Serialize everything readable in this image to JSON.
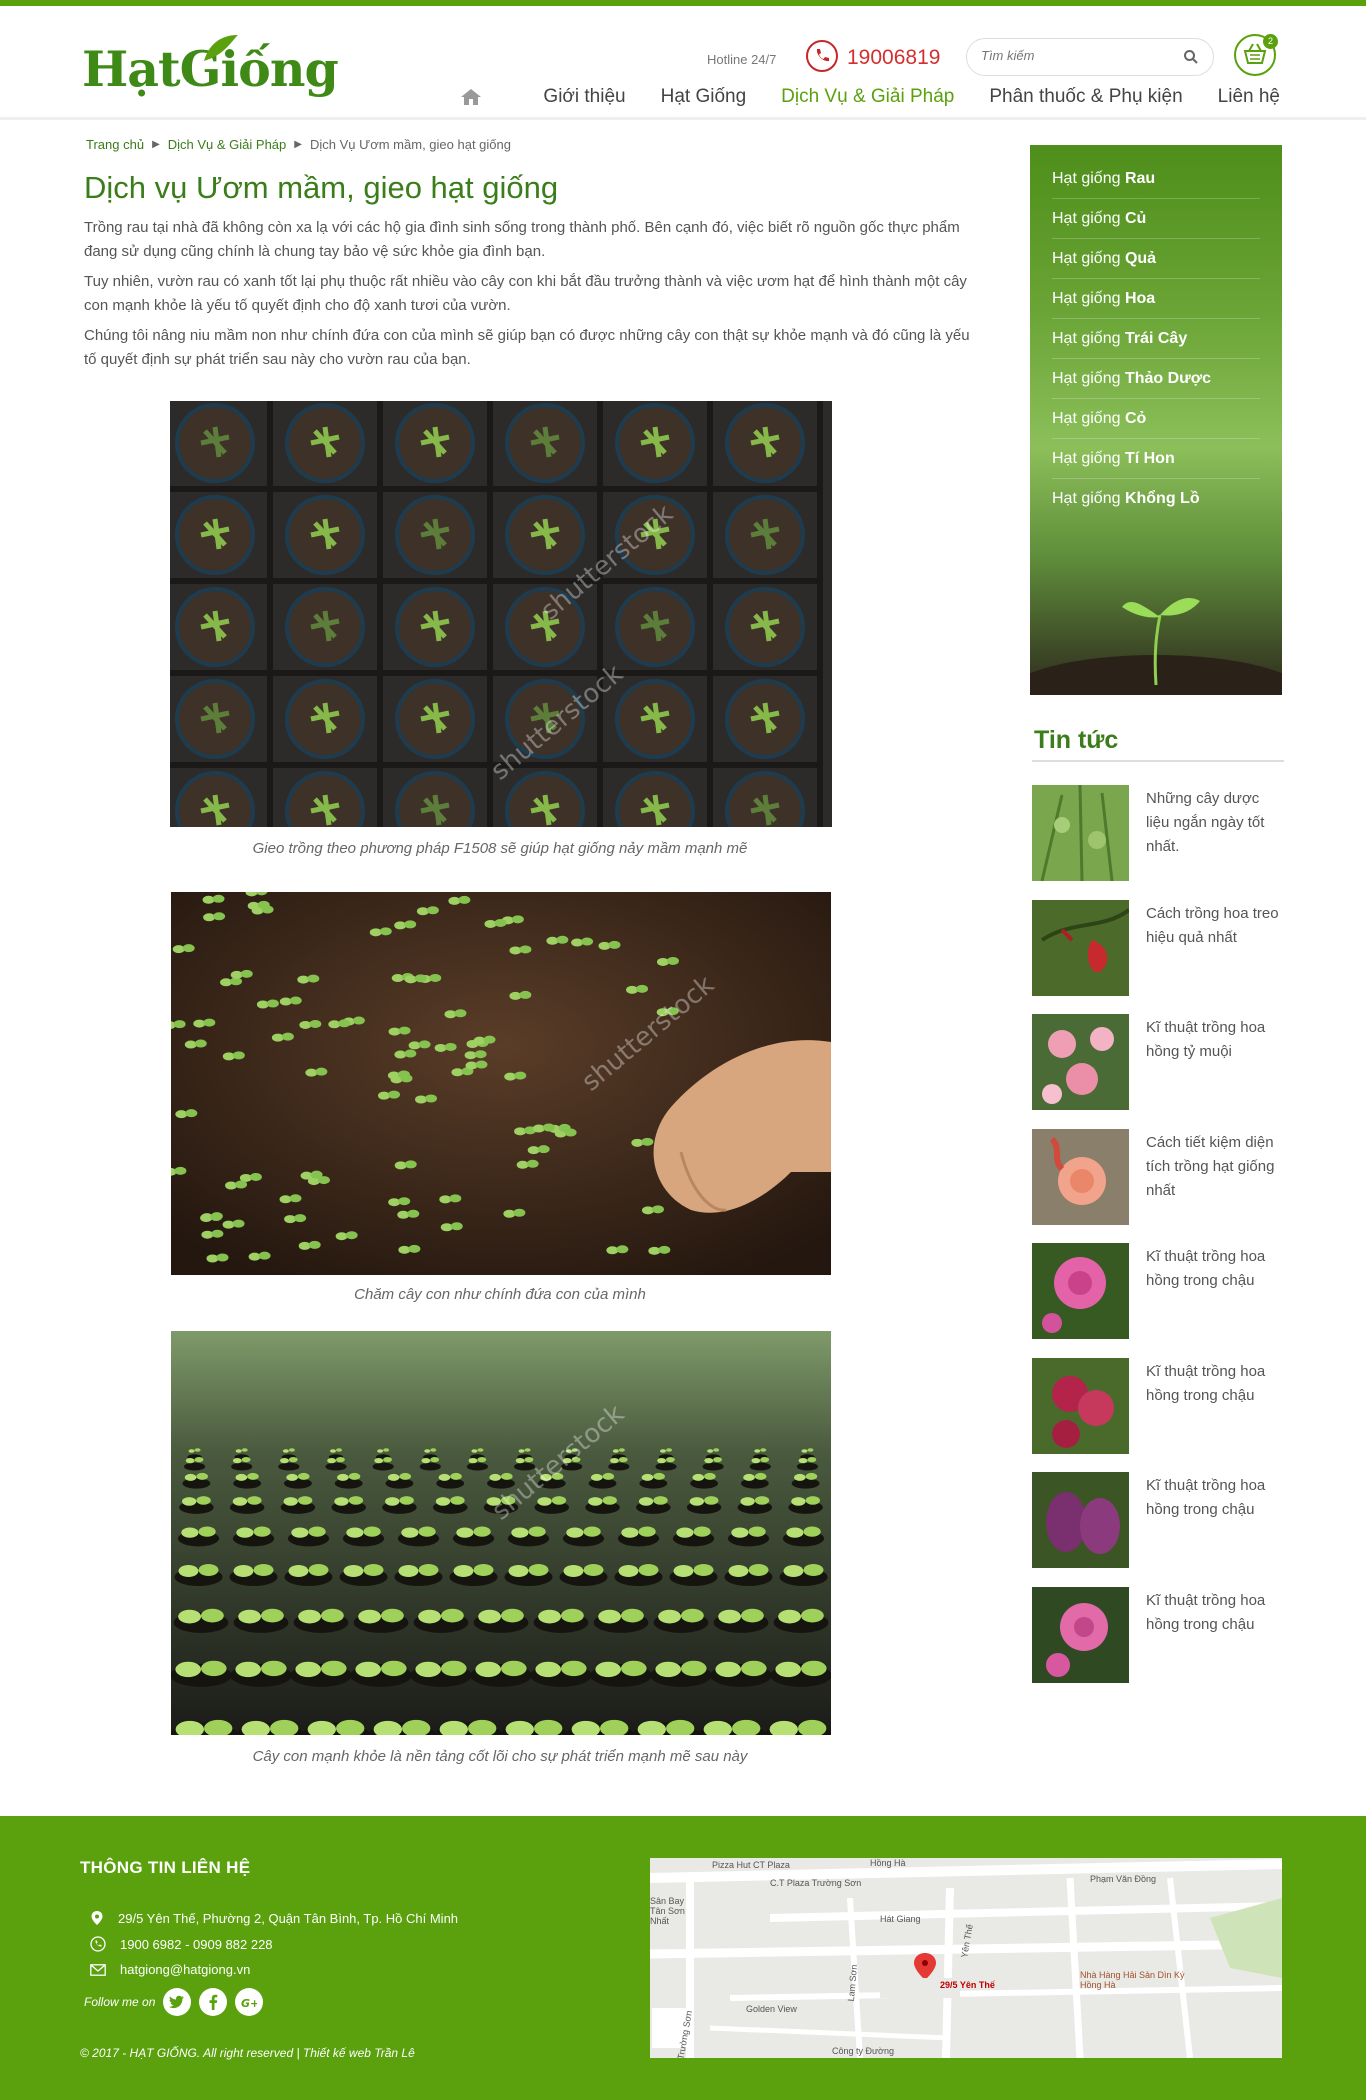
{
  "header": {
    "logo": "HạtGiống",
    "hotline_label": "Hotline 24/7",
    "hotline_number": "19006819",
    "search_placeholder": "Tìm kiếm",
    "cart_count": "2",
    "nav": [
      "Giới thiệu",
      "Hạt Giống",
      "Dịch Vụ & Giải Pháp",
      "Phân thuốc & Phụ kiện",
      "Liên hệ"
    ],
    "nav_active_index": 2
  },
  "breadcrumb": [
    "Trang chủ",
    "Dịch Vụ & Giải Pháp",
    "Dịch Vụ Ươm mầm, gieo hạt giống"
  ],
  "article": {
    "title": "Dịch vụ Ươm mầm, gieo hạt giống",
    "paragraphs": [
      "Trồng rau tại nhà đã không còn xa lạ với các hộ gia đình sinh sống trong thành phố. Bên cạnh đó, việc biết rõ nguồn gốc thực phẩm đang sử dụng cũng chính là chung tay bảo vệ sức khỏe gia đình bạn.",
      "Tuy nhiên, vườn rau có xanh tốt lại phụ thuộc rất nhiều vào cây con khi bắt đầu trưởng thành và việc ươm hạt để hình thành một cây con mạnh khỏe là yếu tố quyết định cho độ xanh tươi của vườn.",
      "Chúng tôi nâng niu mầm non như chính đứa con của mình sẽ giúp bạn có được những cây con thật sự khỏe mạnh và đó cũng là yếu tố quyết định sự phát triển sau này cho vườn rau của bạn."
    ],
    "captions": [
      "Gieo trồng theo phương pháp F1508 sẽ giúp hạt giống nảy mầm mạnh mẽ",
      "Chăm cây con như chính đứa con của mình",
      "Cây con mạnh khỏe là nền tảng cốt lõi cho sự phát triển mạnh mẽ sau này"
    ],
    "watermark": "shutterstock"
  },
  "sidebar": {
    "prefix": "Hạt giống",
    "categories": [
      "Rau",
      "Củ",
      "Quả",
      "Hoa",
      "Trái Cây",
      "Thảo Dược",
      "Cỏ",
      "Tí Hon",
      "Khổng Lồ"
    ]
  },
  "news": {
    "title": "Tin tức",
    "items": [
      "Những cây dược liệu ngắn ngày tốt nhất.",
      "Cách trồng hoa treo hiệu quả nhất",
      "Kĩ thuật trồng hoa hồng tỷ muội",
      "Cách tiết kiệm diện tích trồng hạt giống nhất",
      "Kĩ thuật trồng hoa hồng trong chậu",
      "Kĩ thuật trồng hoa hồng trong chậu",
      "Kĩ thuật trồng hoa hồng trong chậu",
      "Kĩ thuật trồng hoa hồng trong chậu"
    ]
  },
  "footer": {
    "title": "THÔNG TIN LIÊN HỆ",
    "address": "29/5 Yên Thế, Phường 2, Quận Tân Bình, Tp. Hồ Chí Minh",
    "phone": "1900 6982 - 0909 882 228",
    "email": "hatgiong@hatgiong.vn",
    "follow": "Follow me on",
    "copyright": "© 2017 - HẠT GIỐNG. All right reserved   |   Thiết kế web Trần Lê",
    "map_labels": [
      "Pizza Hut CT Plaza",
      "C.T Plaza Trường Sơn",
      "Hát Giang",
      "Phạm Văn Đồng",
      "Hồng Hà",
      "Yên Thế",
      "29/5 Yên Thế",
      "Nhà Hàng Hải Sản Dìn Ký Hồng Hà",
      "Golden View",
      "Lam Sơn",
      "Công ty Đường",
      "Sân Bay Tân Sơn Nhất",
      "Trường Sơn"
    ]
  },
  "colors": {
    "brand_green": "#5aa10d",
    "dark_green": "#3b7d1a",
    "hotline_red": "#d32f2f"
  }
}
